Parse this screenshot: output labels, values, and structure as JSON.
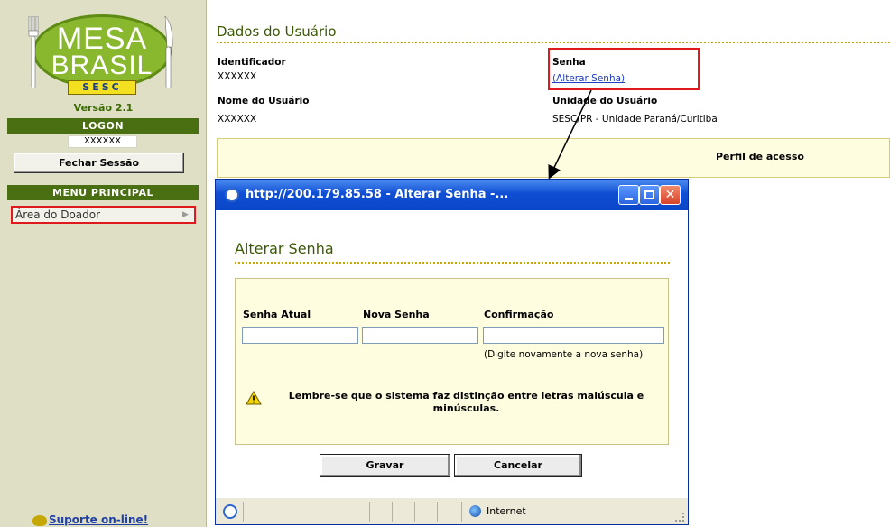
{
  "sidebar": {
    "logo": {
      "line1": "MESA",
      "line2": "BRASIL",
      "badge": "SESC"
    },
    "version": "Versão 2.1",
    "logon_header": "LOGON",
    "user": "XXXXXX",
    "logout_button": "Fechar Sessão",
    "menu_header": "MENU PRINCIPAL",
    "menu_items": [
      {
        "label": "Área do Doador"
      }
    ],
    "support_link": "Suporte on-line!"
  },
  "main": {
    "title": "Dados do Usuário",
    "fields": {
      "identificador_label": "Identificador",
      "identificador_value": "XXXXXX",
      "senha_label": "Senha",
      "senha_link": "(Alterar Senha)",
      "nome_label": "Nome do Usuário",
      "nome_value": "XXXXXX",
      "unidade_label": "Unidade do Usuário",
      "unidade_value": "SESC/PR - Unidade Paraná/Curitiba"
    },
    "perfil_header": "Perfil de acesso"
  },
  "popup": {
    "window_title": "http://200.179.85.58 - Alterar Senha -...",
    "title": "Alterar Senha",
    "senha_atual_label": "Senha Atual",
    "nova_senha_label": "Nova Senha",
    "confirmacao_label": "Confirmação",
    "senha_atual_value": "",
    "nova_senha_value": "",
    "confirmacao_value": "",
    "hint": "(Digite novamente a nova senha)",
    "warning": "Lembre-se que o sistema faz distinção entre letras maiúscula e minúsculas.",
    "gravar_button": "Gravar",
    "cancelar_button": "Cancelar",
    "status_zone": "Internet"
  },
  "colors": {
    "sidebar_bg": "#dfdfc6",
    "sidebar_bar": "#4a6e12",
    "highlight_red": "#e0191c",
    "heading_green": "#3a5a00",
    "link_blue": "#1f3fc4",
    "panel_yellow": "#fffde0",
    "xp_blue": "#0f4ed3"
  }
}
